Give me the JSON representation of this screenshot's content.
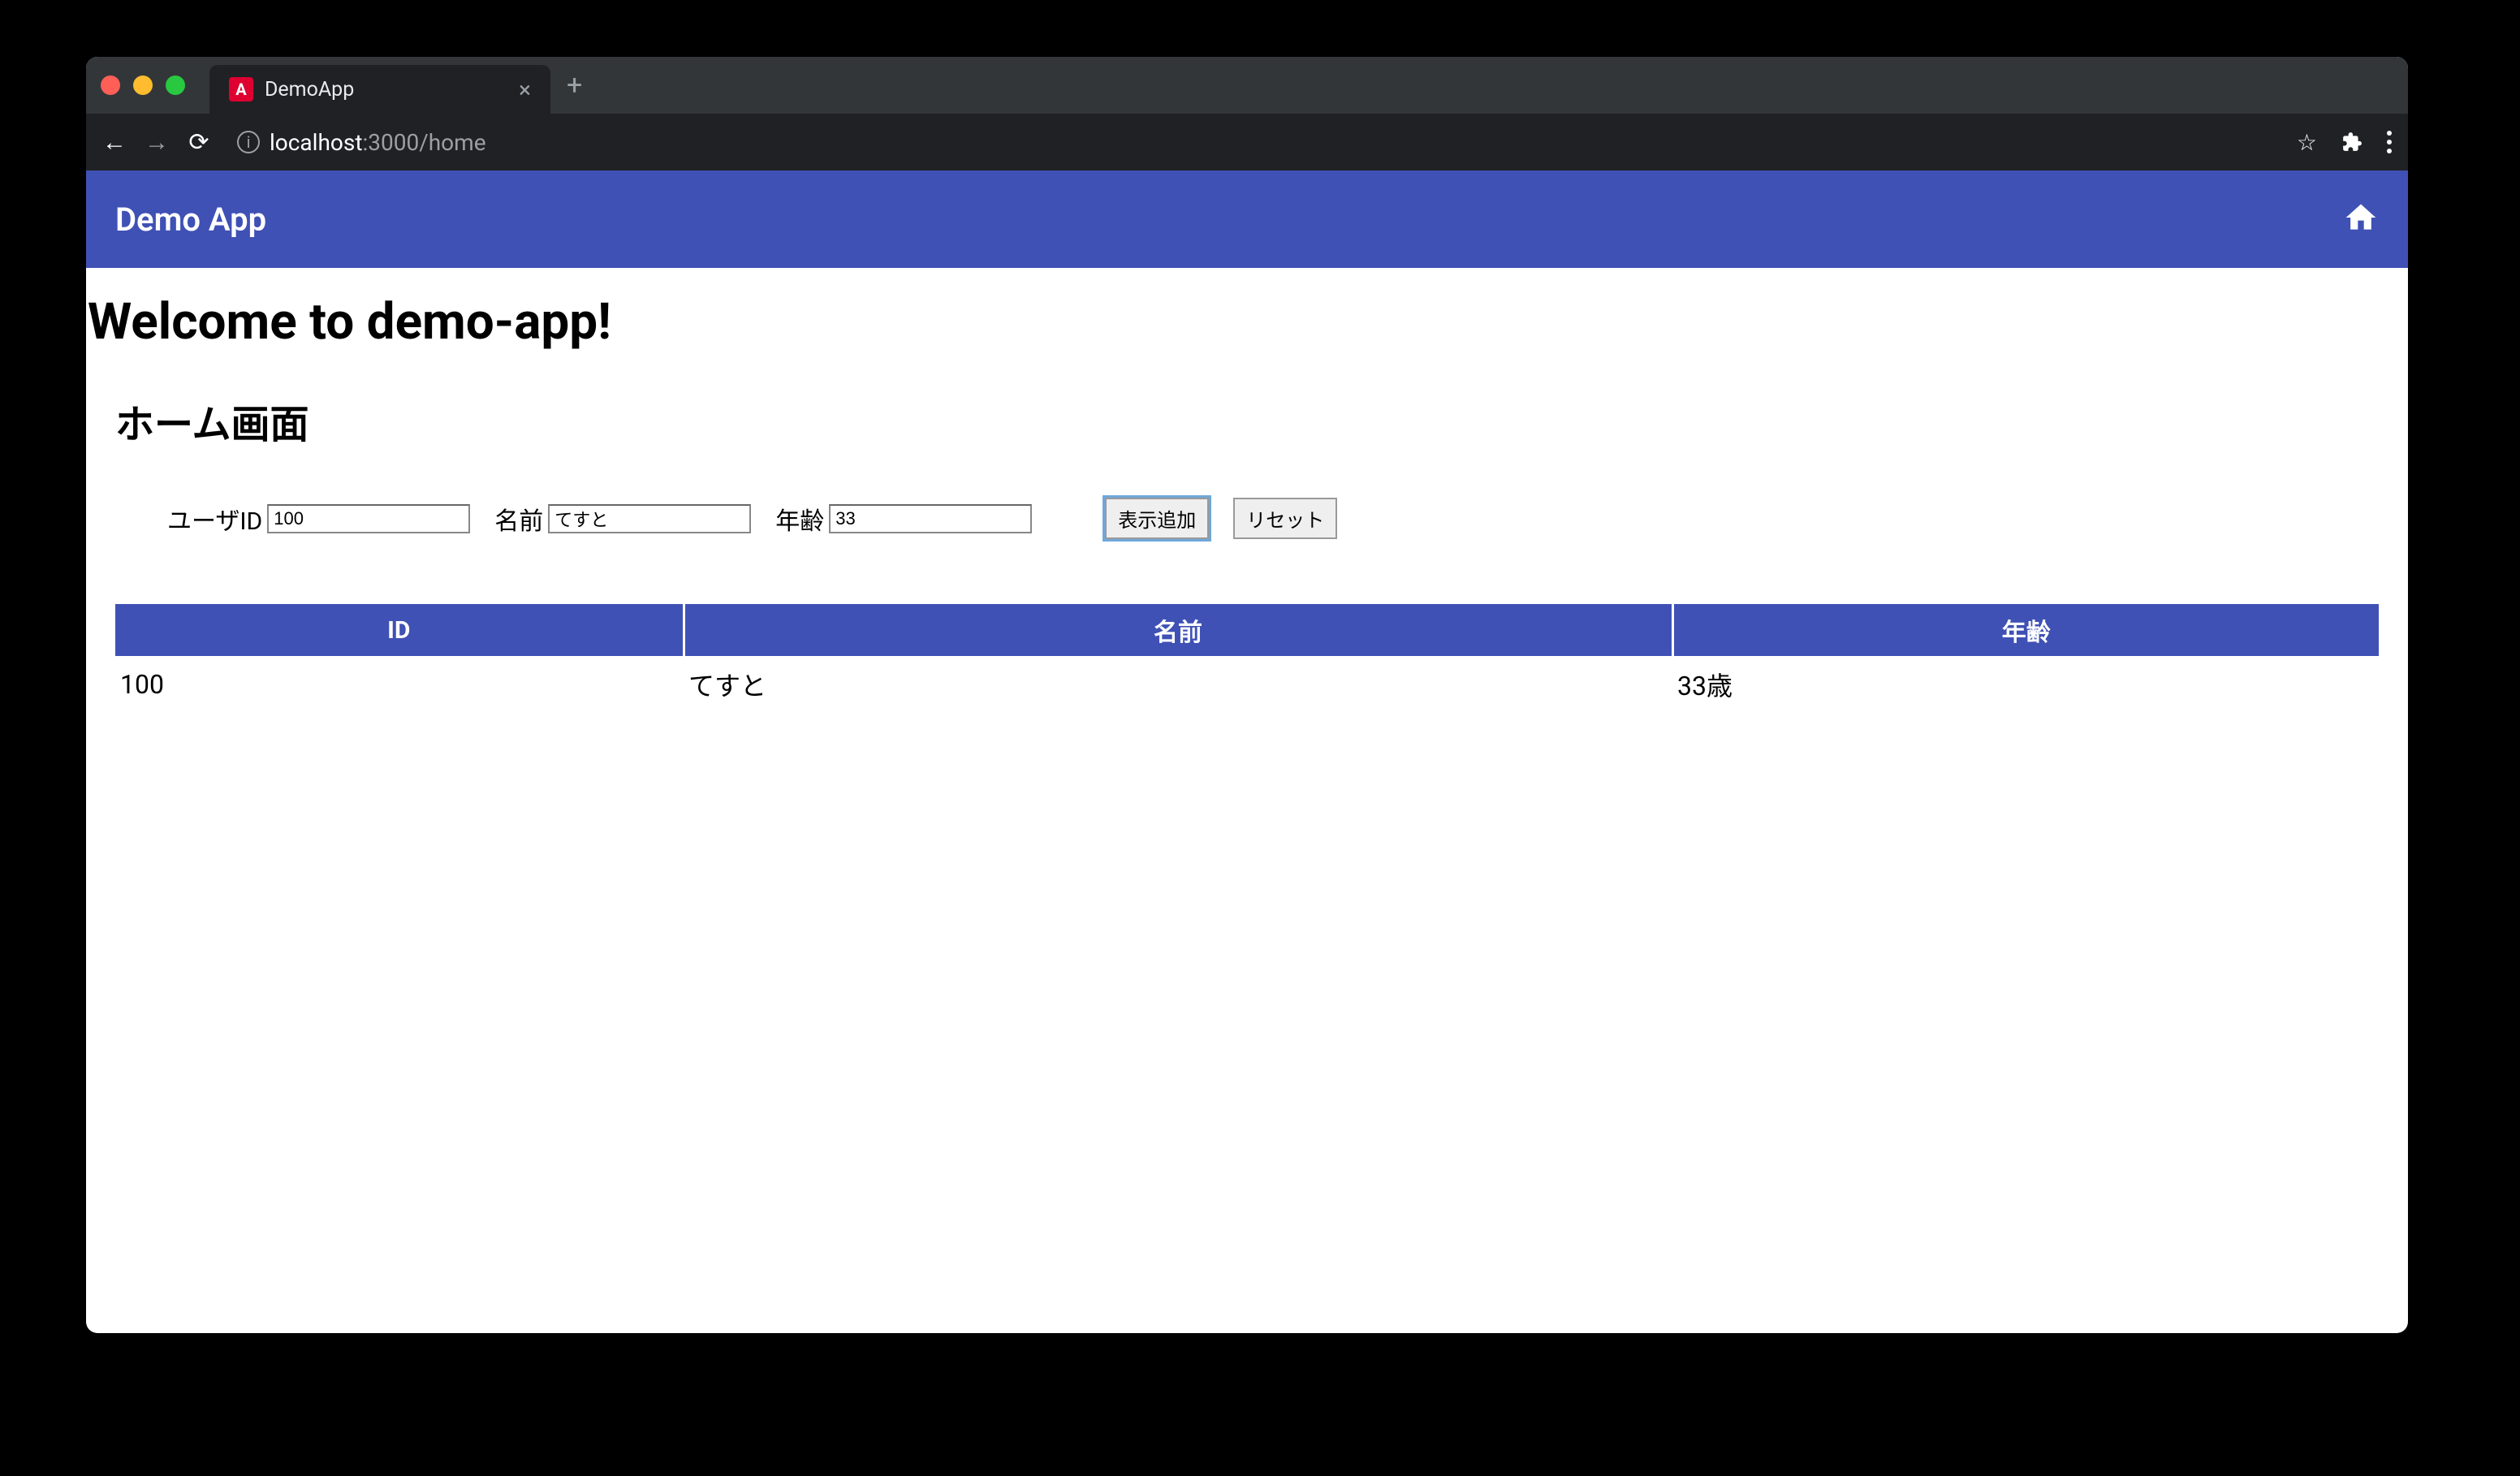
{
  "browser": {
    "tab_title": "DemoApp",
    "url_host": "localhost",
    "url_port_path": ":3000/home"
  },
  "header": {
    "app_title": "Demo App"
  },
  "page": {
    "welcome": "Welcome to demo-app!",
    "subtitle": "ホーム画面"
  },
  "form": {
    "user_id_label": "ユーザID",
    "user_id_value": "100",
    "name_label": "名前",
    "name_value": "てすと",
    "age_label": "年齢",
    "age_value": "33",
    "add_button": "表示追加",
    "reset_button": "リセット"
  },
  "table": {
    "headers": {
      "id": "ID",
      "name": "名前",
      "age": "年齢"
    },
    "rows": [
      {
        "id": "100",
        "name": "てすと",
        "age": "33歳"
      }
    ]
  }
}
